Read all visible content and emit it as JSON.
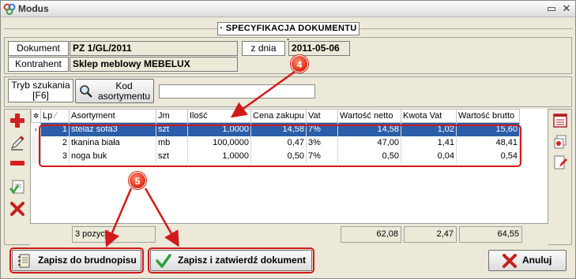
{
  "window": {
    "title": "Modus",
    "minimize_glyph": "▭",
    "close_glyph": "✕"
  },
  "header": {
    "title": "· SPECYFIKACJA DOKUMENTU ·"
  },
  "document": {
    "doc_label": "Dokument",
    "doc_value": "PZ 1/GL/2011",
    "date_label": "z dnia",
    "date_value": "2011-05-06",
    "contractor_label": "Kontrahent",
    "contractor_value": "Sklep meblowy MEBELUX"
  },
  "search": {
    "mode_label_line1": "Tryb szukania",
    "mode_label_line2": "[F6]",
    "code_button_line1": "Kod",
    "code_button_line2": "asortymentu",
    "input_value": "",
    "input_placeholder": ""
  },
  "grid": {
    "corner_glyph": "✲",
    "columns": [
      "Lp",
      "Asortyment",
      "Jm",
      "Ilość",
      "Cena zakupu",
      "Vat",
      "Wartość netto",
      "Kwota Vat",
      "Wartość brutto"
    ],
    "sort_glyph": "∕",
    "rows": [
      {
        "indicator": "›",
        "lp": "1",
        "name": "stelaż sofa3",
        "jm": "szt",
        "qty": "1,0000",
        "price": "14,58",
        "vat": "7%",
        "net": "14,58",
        "vat_amount": "1,02",
        "gross": "15,60"
      },
      {
        "indicator": "",
        "lp": "2",
        "name": "tkanina biała",
        "jm": "mb",
        "qty": "100,0000",
        "price": "0,47",
        "vat": "3%",
        "net": "47,00",
        "vat_amount": "1,41",
        "gross": "48,41"
      },
      {
        "indicator": "",
        "lp": "3",
        "name": "noga buk",
        "jm": "szt",
        "qty": "1,0000",
        "price": "0,50",
        "vat": "7%",
        "net": "0,50",
        "vat_amount": "0,04",
        "gross": "0,54"
      }
    ],
    "footer": {
      "count": "3 pozycji",
      "net_total": "62,08",
      "vat_total": "2,47",
      "gross_total": "64,55"
    }
  },
  "buttons": {
    "draft": "Zapisz do brudnopisu",
    "save_confirm": "Zapisz i zatwierdź dokument",
    "cancel": "Anuluj"
  },
  "annotations": {
    "badge_4": "4",
    "badge_5": "5"
  },
  "colors": {
    "selection": "#2a5ea8",
    "annotation_red": "#d11a1a"
  }
}
